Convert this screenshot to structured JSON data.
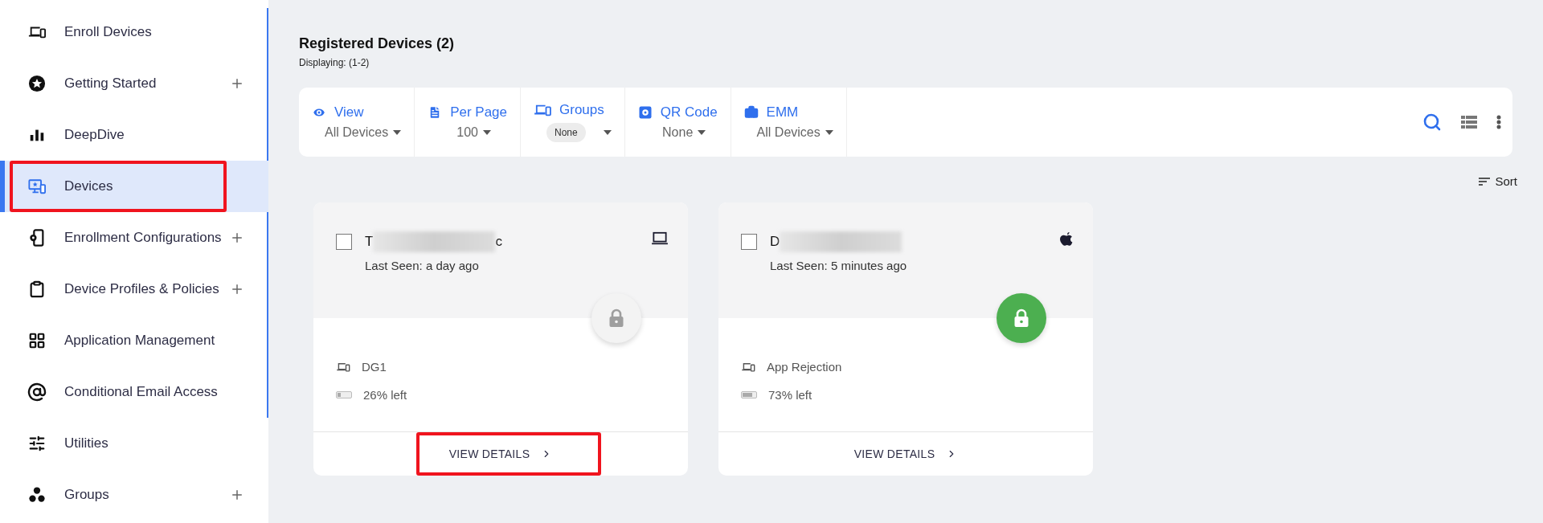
{
  "sidebar": {
    "items": [
      {
        "label": "Enroll Devices",
        "expandable": false,
        "selected": false,
        "highlighted": false
      },
      {
        "label": "Getting Started",
        "expandable": true,
        "selected": false,
        "highlighted": false
      },
      {
        "label": "DeepDive",
        "expandable": false,
        "selected": false,
        "highlighted": false
      },
      {
        "label": "Devices",
        "expandable": false,
        "selected": true,
        "highlighted": true
      },
      {
        "label": "Enrollment Configurations",
        "expandable": true,
        "selected": false,
        "highlighted": false
      },
      {
        "label": "Device Profiles & Policies",
        "expandable": true,
        "selected": false,
        "highlighted": false
      },
      {
        "label": "Application Management",
        "expandable": false,
        "selected": false,
        "highlighted": false
      },
      {
        "label": "Conditional Email Access",
        "expandable": false,
        "selected": false,
        "highlighted": false
      },
      {
        "label": "Utilities",
        "expandable": false,
        "selected": false,
        "highlighted": false
      },
      {
        "label": "Groups",
        "expandable": true,
        "selected": false,
        "highlighted": false
      }
    ]
  },
  "header": {
    "title": "Registered Devices (2)",
    "subtitle": "Displaying: (1-2)"
  },
  "filters": [
    {
      "label": "View",
      "value": "All Devices",
      "kind": "text"
    },
    {
      "label": "Per Page",
      "value": "100",
      "kind": "text"
    },
    {
      "label": "Groups",
      "value": "None",
      "kind": "chip"
    },
    {
      "label": "QR Code",
      "value": "None",
      "kind": "text"
    },
    {
      "label": "EMM",
      "value": "All Devices",
      "kind": "text"
    }
  ],
  "sort": {
    "label": "Sort"
  },
  "devices": [
    {
      "name_start": "T",
      "name_end": "c",
      "checked": false,
      "kind": "laptop",
      "last_seen": "Last Seen: a day ago",
      "secured": false,
      "group": "DG1",
      "battery": {
        "level": 0.26,
        "reading": "26% left"
      },
      "action": "VIEW DETAILS",
      "highlighted": true
    },
    {
      "name_start": "D",
      "checked": false,
      "kind": "apple",
      "last_seen": "Last Seen: 5 minutes ago",
      "secured": true,
      "group": "App Rejection",
      "battery": {
        "level": 0.73,
        "reading": "73% left"
      },
      "action": "VIEW DETAILS",
      "highlighted": false
    }
  ]
}
